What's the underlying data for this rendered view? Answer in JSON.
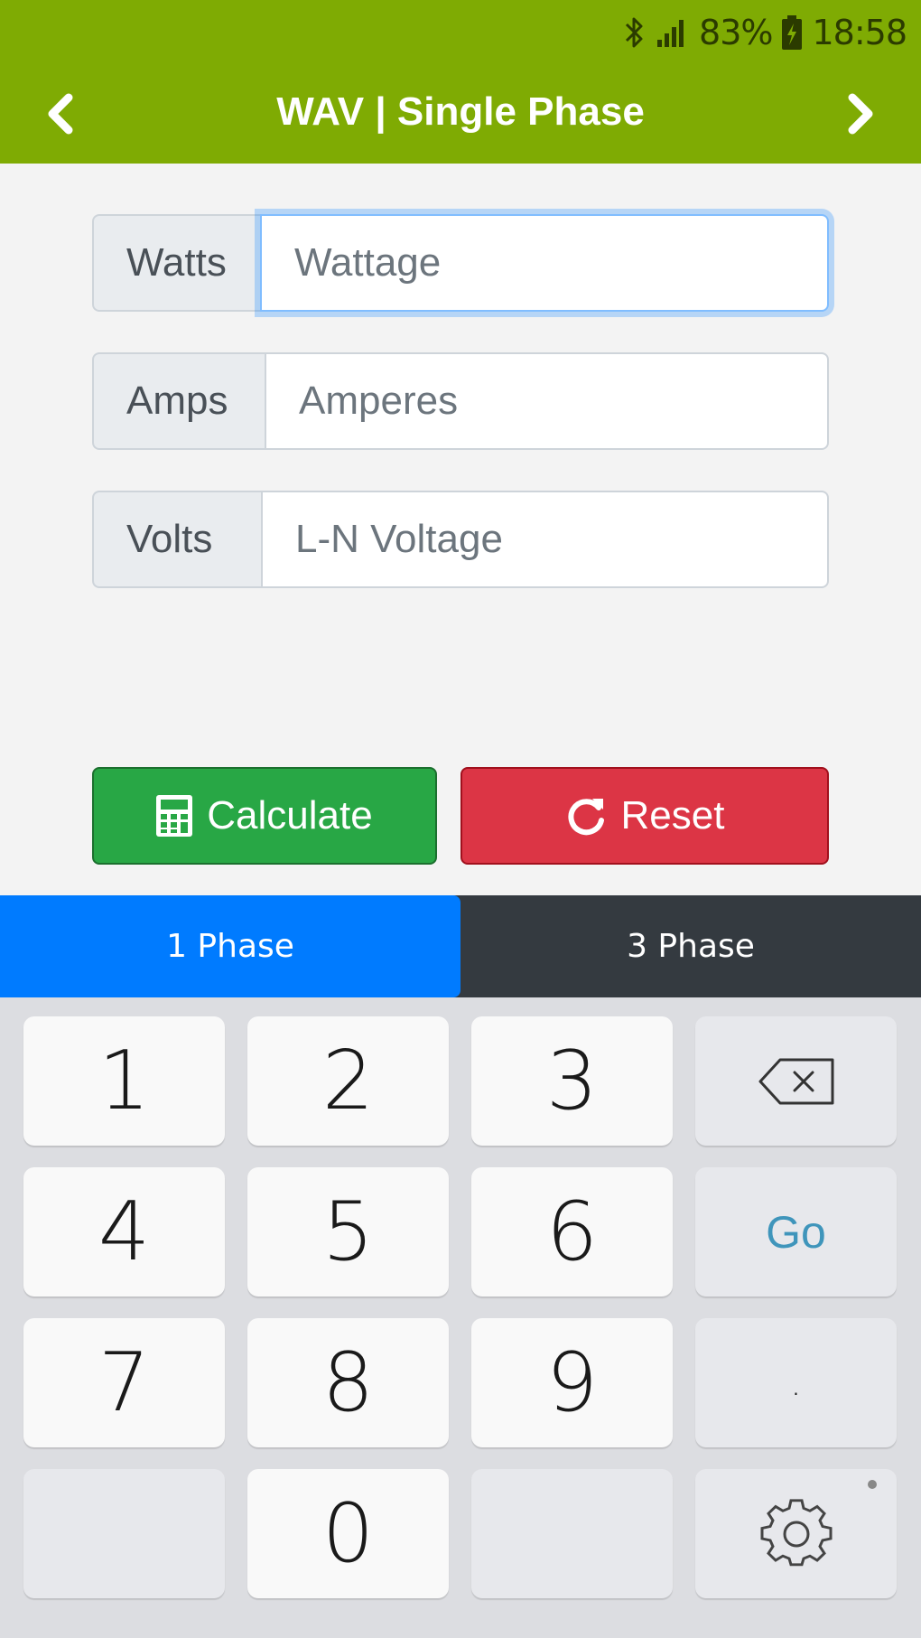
{
  "status_bar": {
    "battery": "83%",
    "time": "18:58",
    "icons": [
      "bluetooth-icon",
      "signal-icon",
      "battery-charging-icon"
    ]
  },
  "header": {
    "title": "WAV | Single Phase",
    "prev_icon": "chevron-left-icon",
    "next_icon": "chevron-right-icon",
    "color": "#7fab03"
  },
  "form": {
    "watts": {
      "label": "Watts",
      "placeholder": "Wattage",
      "value": ""
    },
    "amps": {
      "label": "Amps",
      "placeholder": "Amperes",
      "value": ""
    },
    "volts": {
      "label": "Volts",
      "placeholder": "L-N Voltage",
      "value": ""
    }
  },
  "buttons": {
    "calculate": {
      "label": "Calculate",
      "icon": "calculator-icon",
      "color": "#28a745"
    },
    "reset": {
      "label": "Reset",
      "icon": "refresh-icon",
      "color": "#dc3545"
    }
  },
  "tabs": [
    {
      "label": "1 Phase",
      "active": true,
      "color": "#007bff"
    },
    {
      "label": "3 Phase",
      "active": false,
      "color": "#343a40"
    }
  ],
  "keyboard": {
    "keys": [
      "1",
      "2",
      "3",
      "4",
      "5",
      "6",
      "7",
      "8",
      "9",
      "0"
    ],
    "go_label": "Go",
    "dot_label": ".",
    "backspace_icon": "backspace-icon",
    "settings_icon": "gear-icon"
  }
}
